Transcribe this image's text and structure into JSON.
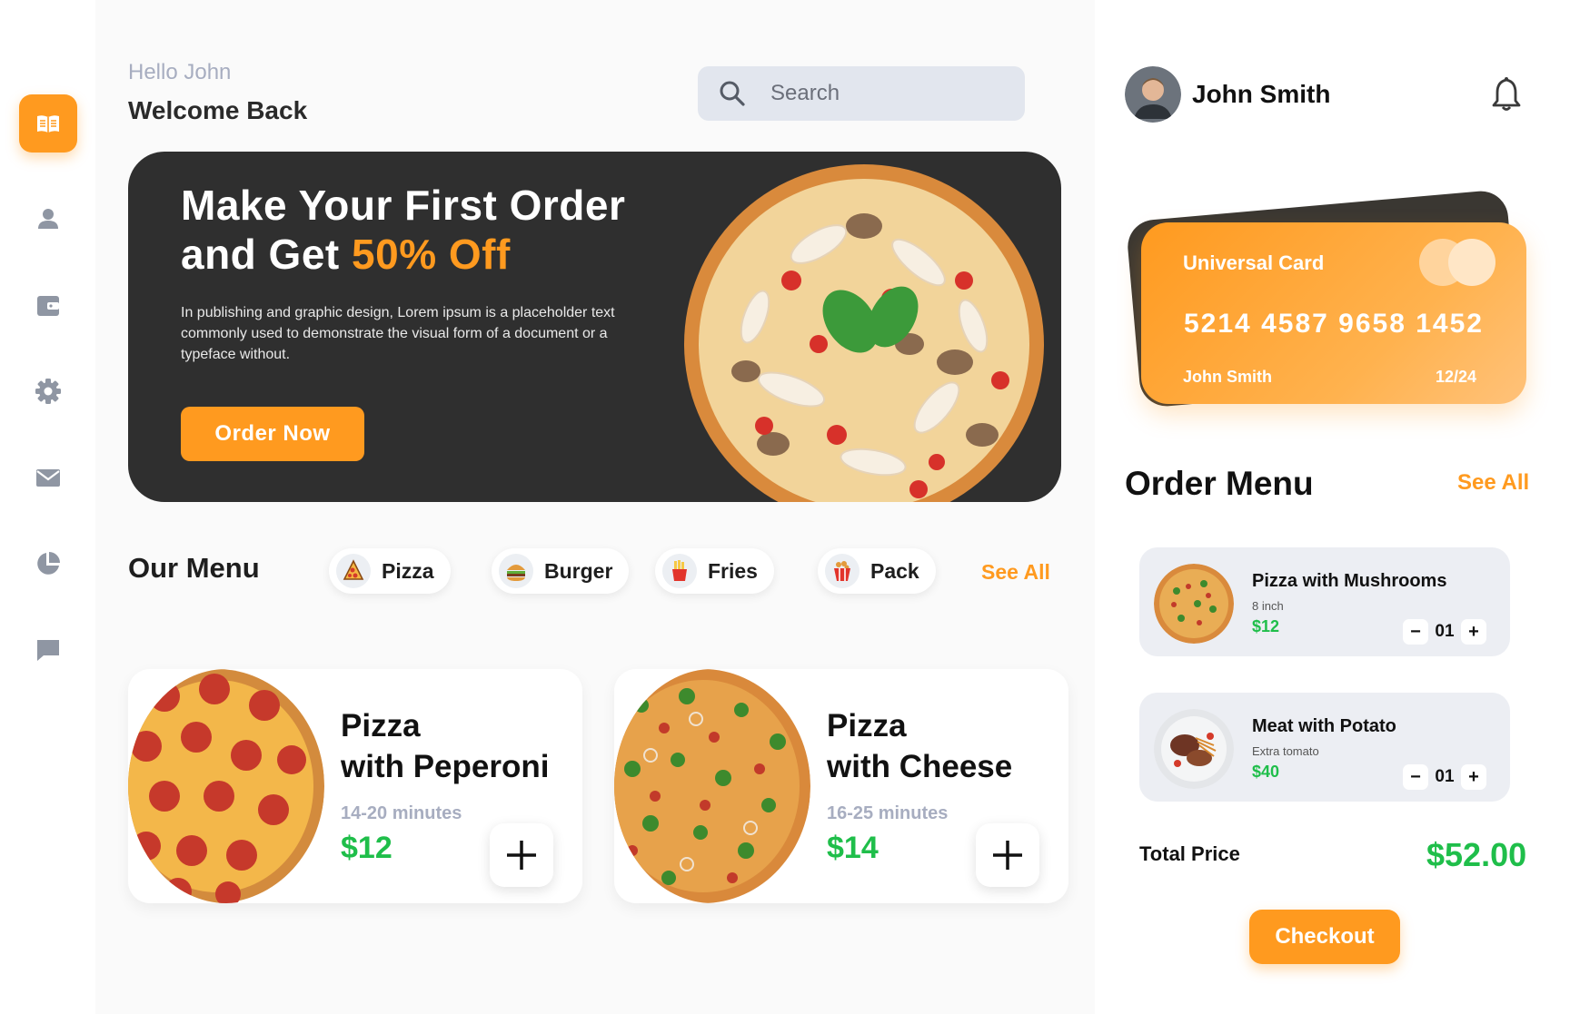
{
  "greeting": "Hello John",
  "welcome": "Welcome Back",
  "search": {
    "placeholder": "Search"
  },
  "sidebar": {
    "items": [
      {
        "icon": "menu-book-icon",
        "active": true
      },
      {
        "icon": "user-icon"
      },
      {
        "icon": "wallet-icon"
      },
      {
        "icon": "gear-icon"
      },
      {
        "icon": "mail-icon"
      },
      {
        "icon": "pie-chart-icon"
      },
      {
        "icon": "chat-icon"
      }
    ]
  },
  "banner": {
    "title_line1": "Make Your First Order",
    "title_line2_prefix": "and Get ",
    "title_highlight": "50% Off",
    "description": "In publishing and graphic design, Lorem ipsum is a placeholder text commonly used to demonstrate the visual form of a document or a typeface without.",
    "button": "Order Now"
  },
  "menu": {
    "title": "Our Menu",
    "categories": [
      {
        "label": "Pizza",
        "icon": "pizza-slice-icon"
      },
      {
        "label": "Burger",
        "icon": "burger-icon"
      },
      {
        "label": "Fries",
        "icon": "fries-icon"
      },
      {
        "label": "Pack",
        "icon": "pack-icon"
      }
    ],
    "see_all": "See All",
    "items": [
      {
        "line1": "Pizza",
        "line2": "with Peperoni",
        "time": "14-20 minutes",
        "price": "$12"
      },
      {
        "line1": "Pizza",
        "line2": "with Cheese",
        "time": "16-25 minutes",
        "price": "$14"
      }
    ]
  },
  "user": {
    "name": "John Smith"
  },
  "card": {
    "name": "Universal Card",
    "number": "5214 4587 9658 1452",
    "holder": "John Smith",
    "expiry": "12/24"
  },
  "order": {
    "title": "Order Menu",
    "see_all": "See All",
    "items": [
      {
        "name": "Pizza with Mushrooms",
        "sub": "8 inch",
        "price": "$12",
        "qty": "01"
      },
      {
        "name": "Meat with Potato",
        "sub": "Extra tomato",
        "price": "$40",
        "qty": "01"
      }
    ],
    "total_label": "Total Price",
    "total_value": "$52.00",
    "checkout": "Checkout"
  },
  "colors": {
    "accent": "#ff9a1f",
    "price": "#1fbe4a",
    "dark": "#2f2f2f"
  }
}
